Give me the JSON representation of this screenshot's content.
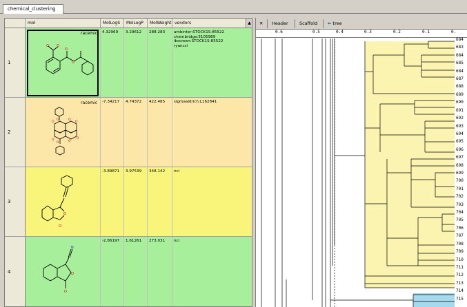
{
  "tab": {
    "label": "chemical_clustering"
  },
  "table": {
    "headers": [
      "mol",
      "MolLogS",
      "MolLogP",
      "MolWeight",
      "vendors"
    ],
    "rows": [
      {
        "num": "1",
        "tag": "racemic",
        "logs": "4.32969",
        "logp": "3.29612",
        "mw": "288.283",
        "vendors": [
          "ambinter:STOCK1S-85522",
          "chembridge:5105989",
          "ibscreen:STOCK1S-85522",
          "ryancci"
        ],
        "bg": "#a8ef9c"
      },
      {
        "num": "2",
        "tag": "racemic",
        "logs": "-7.34217",
        "logp": "4.74372",
        "mw": "422.485",
        "vendors": [
          "sigmaaldrich:L162841"
        ],
        "bg": "#fce6a8"
      },
      {
        "num": "3",
        "tag": "",
        "logs": "-3.89871",
        "logp": "3.97539",
        "mw": "348.142",
        "vendors": [
          "nci"
        ],
        "bg": "#f8f57a"
      },
      {
        "num": "4",
        "tag": "",
        "logs": "-2.86197",
        "logp": "1.61261",
        "mw": "273.031",
        "vendors": [
          "nci"
        ],
        "bg": "#a8ef9c"
      }
    ]
  },
  "tree": {
    "close_label": "✕",
    "header_label": "Header",
    "scaffold_label": "Scaffold",
    "tree_label": "tree",
    "scale": [
      "0.6",
      "0.5",
      "0.4",
      "0.3",
      "0.2",
      "0.1",
      "0."
    ],
    "leaves": [
      "684",
      "683",
      "684",
      "685",
      "684",
      "687",
      "688",
      "689",
      "690",
      "691",
      "692",
      "693",
      "694",
      "695",
      "696",
      "697",
      "698",
      "699",
      "700",
      "701",
      "702",
      "703",
      "704",
      "705",
      "706",
      "707",
      "708",
      "709",
      "710",
      "711",
      "712",
      "713",
      "714",
      "715"
    ],
    "yellow_color": "#fbf3b0",
    "blue_color": "#a6d9ee"
  },
  "colors": {
    "selected_border": "#000000"
  }
}
